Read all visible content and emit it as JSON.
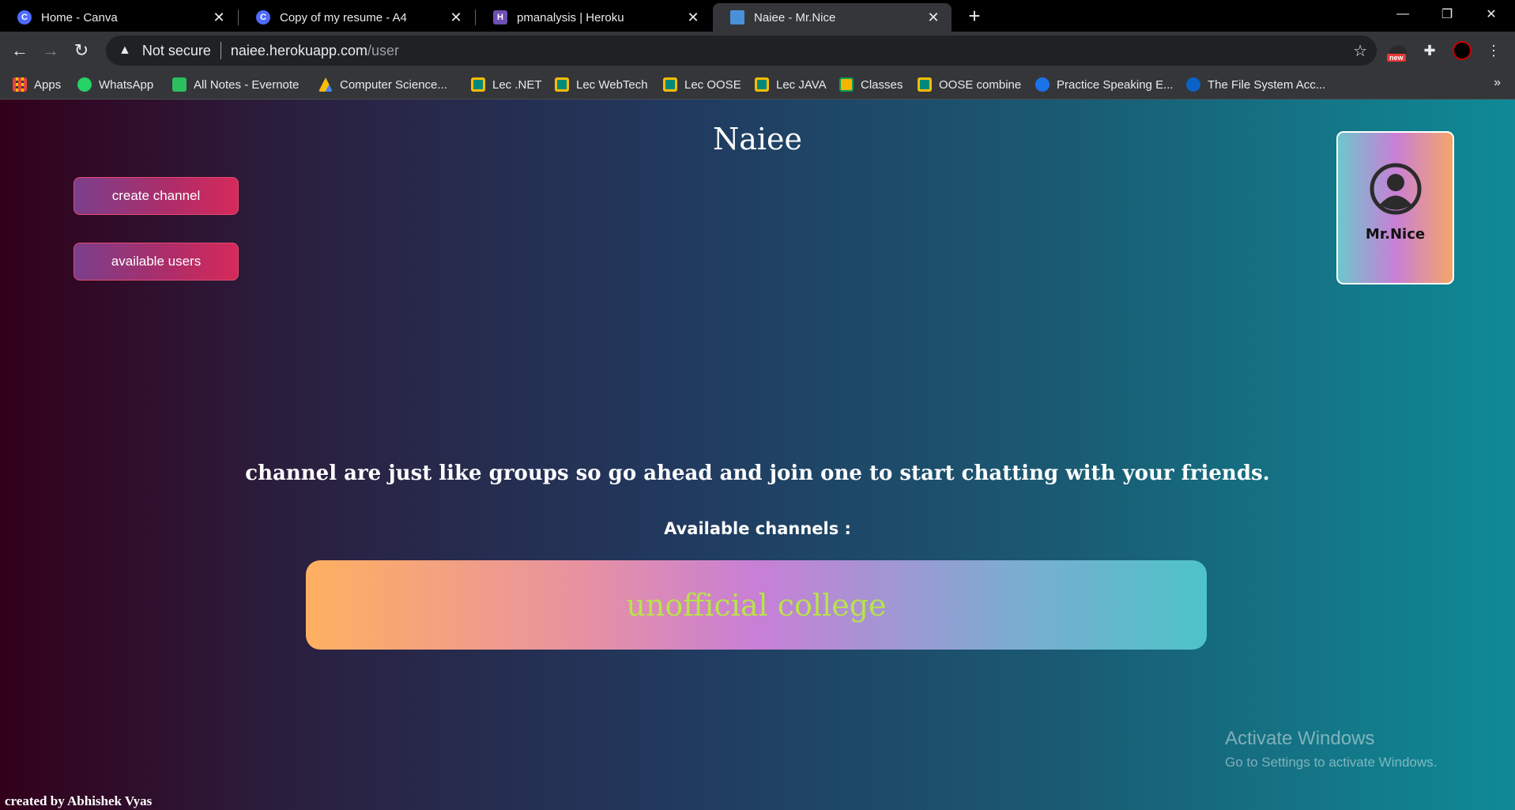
{
  "browser": {
    "tabs": [
      {
        "title": "Home - Canva",
        "favicon": "canva-icon",
        "color": "#4d6bfe",
        "glyph": "C"
      },
      {
        "title": "Copy of my resume - A4",
        "favicon": "canva-icon",
        "color": "#4d6bfe",
        "glyph": "C"
      },
      {
        "title": "pmanalysis | Heroku",
        "favicon": "heroku-icon",
        "color": "#6e4fb3",
        "glyph": "H"
      },
      {
        "title": "Naiee - Mr.Nice",
        "favicon": "page-icon",
        "color": "#4a90d9",
        "glyph": ""
      }
    ],
    "active_tab": 3,
    "address": {
      "security": "Not secure",
      "host": "naiee.herokuapp.com",
      "path": "/user"
    },
    "extension_badge": "new",
    "bookmarks": [
      {
        "label": "Apps",
        "icon": "apps-grid-icon",
        "color": "#e8453c"
      },
      {
        "label": "WhatsApp",
        "icon": "whatsapp-icon",
        "color": "#25d366"
      },
      {
        "label": "All Notes - Evernote",
        "icon": "evernote-icon",
        "color": "#2dbe60"
      },
      {
        "label": "Computer Science...",
        "icon": "google-drive-icon",
        "color": "#fbbc04"
      },
      {
        "label": "Lec .NET",
        "icon": "google-meet-icon",
        "color": "#00897b"
      },
      {
        "label": "Lec WebTech",
        "icon": "google-meet-icon",
        "color": "#00897b"
      },
      {
        "label": "Lec OOSE",
        "icon": "google-meet-icon",
        "color": "#00897b"
      },
      {
        "label": "Lec JAVA",
        "icon": "google-meet-icon",
        "color": "#00897b"
      },
      {
        "label": "Classes",
        "icon": "google-classroom-icon",
        "color": "#f4b400"
      },
      {
        "label": "OOSE combine",
        "icon": "google-meet-icon",
        "color": "#00897b"
      },
      {
        "label": "Practice Speaking E...",
        "icon": "globe-icon",
        "color": "#1a73e8"
      },
      {
        "label": "The File System Acc...",
        "icon": "powershell-icon",
        "color": "#0b62c4"
      }
    ]
  },
  "page": {
    "title": "Naiee",
    "buttons": {
      "create_channel": "create channel",
      "available_users": "available users"
    },
    "profile": {
      "name": "Mr.Nice",
      "icon": "user-avatar-icon"
    },
    "tagline": "channel are just like groups so go ahead and join one to start chatting with your friends.",
    "available_heading": "Available channels :",
    "channels": [
      {
        "name": "unofficial college"
      }
    ],
    "credit": "created by Abhishek Vyas"
  },
  "os_watermark": {
    "line1": "Activate Windows",
    "line2": "Go to Settings to activate Windows."
  },
  "colors": {
    "accent_button": "#c2306a",
    "channel_text": "#b9e34a"
  }
}
